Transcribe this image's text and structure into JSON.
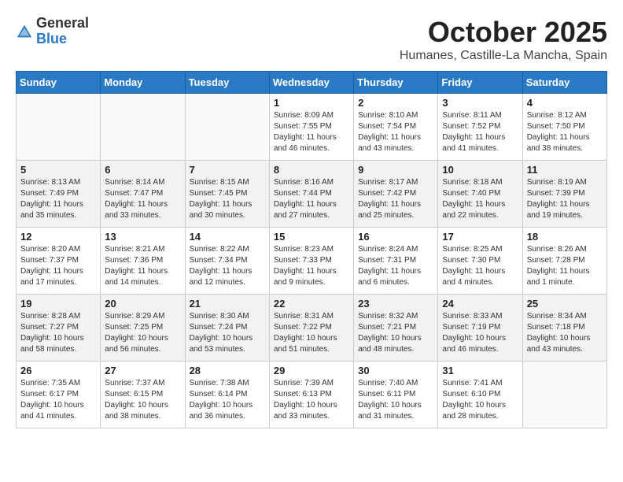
{
  "header": {
    "logo_general": "General",
    "logo_blue": "Blue",
    "month": "October 2025",
    "location": "Humanes, Castille-La Mancha, Spain"
  },
  "weekdays": [
    "Sunday",
    "Monday",
    "Tuesday",
    "Wednesday",
    "Thursday",
    "Friday",
    "Saturday"
  ],
  "weeks": [
    [
      {
        "day": "",
        "info": ""
      },
      {
        "day": "",
        "info": ""
      },
      {
        "day": "",
        "info": ""
      },
      {
        "day": "1",
        "info": "Sunrise: 8:09 AM\nSunset: 7:55 PM\nDaylight: 11 hours\nand 46 minutes."
      },
      {
        "day": "2",
        "info": "Sunrise: 8:10 AM\nSunset: 7:54 PM\nDaylight: 11 hours\nand 43 minutes."
      },
      {
        "day": "3",
        "info": "Sunrise: 8:11 AM\nSunset: 7:52 PM\nDaylight: 11 hours\nand 41 minutes."
      },
      {
        "day": "4",
        "info": "Sunrise: 8:12 AM\nSunset: 7:50 PM\nDaylight: 11 hours\nand 38 minutes."
      }
    ],
    [
      {
        "day": "5",
        "info": "Sunrise: 8:13 AM\nSunset: 7:49 PM\nDaylight: 11 hours\nand 35 minutes."
      },
      {
        "day": "6",
        "info": "Sunrise: 8:14 AM\nSunset: 7:47 PM\nDaylight: 11 hours\nand 33 minutes."
      },
      {
        "day": "7",
        "info": "Sunrise: 8:15 AM\nSunset: 7:45 PM\nDaylight: 11 hours\nand 30 minutes."
      },
      {
        "day": "8",
        "info": "Sunrise: 8:16 AM\nSunset: 7:44 PM\nDaylight: 11 hours\nand 27 minutes."
      },
      {
        "day": "9",
        "info": "Sunrise: 8:17 AM\nSunset: 7:42 PM\nDaylight: 11 hours\nand 25 minutes."
      },
      {
        "day": "10",
        "info": "Sunrise: 8:18 AM\nSunset: 7:40 PM\nDaylight: 11 hours\nand 22 minutes."
      },
      {
        "day": "11",
        "info": "Sunrise: 8:19 AM\nSunset: 7:39 PM\nDaylight: 11 hours\nand 19 minutes."
      }
    ],
    [
      {
        "day": "12",
        "info": "Sunrise: 8:20 AM\nSunset: 7:37 PM\nDaylight: 11 hours\nand 17 minutes."
      },
      {
        "day": "13",
        "info": "Sunrise: 8:21 AM\nSunset: 7:36 PM\nDaylight: 11 hours\nand 14 minutes."
      },
      {
        "day": "14",
        "info": "Sunrise: 8:22 AM\nSunset: 7:34 PM\nDaylight: 11 hours\nand 12 minutes."
      },
      {
        "day": "15",
        "info": "Sunrise: 8:23 AM\nSunset: 7:33 PM\nDaylight: 11 hours\nand 9 minutes."
      },
      {
        "day": "16",
        "info": "Sunrise: 8:24 AM\nSunset: 7:31 PM\nDaylight: 11 hours\nand 6 minutes."
      },
      {
        "day": "17",
        "info": "Sunrise: 8:25 AM\nSunset: 7:30 PM\nDaylight: 11 hours\nand 4 minutes."
      },
      {
        "day": "18",
        "info": "Sunrise: 8:26 AM\nSunset: 7:28 PM\nDaylight: 11 hours\nand 1 minute."
      }
    ],
    [
      {
        "day": "19",
        "info": "Sunrise: 8:28 AM\nSunset: 7:27 PM\nDaylight: 10 hours\nand 58 minutes."
      },
      {
        "day": "20",
        "info": "Sunrise: 8:29 AM\nSunset: 7:25 PM\nDaylight: 10 hours\nand 56 minutes."
      },
      {
        "day": "21",
        "info": "Sunrise: 8:30 AM\nSunset: 7:24 PM\nDaylight: 10 hours\nand 53 minutes."
      },
      {
        "day": "22",
        "info": "Sunrise: 8:31 AM\nSunset: 7:22 PM\nDaylight: 10 hours\nand 51 minutes."
      },
      {
        "day": "23",
        "info": "Sunrise: 8:32 AM\nSunset: 7:21 PM\nDaylight: 10 hours\nand 48 minutes."
      },
      {
        "day": "24",
        "info": "Sunrise: 8:33 AM\nSunset: 7:19 PM\nDaylight: 10 hours\nand 46 minutes."
      },
      {
        "day": "25",
        "info": "Sunrise: 8:34 AM\nSunset: 7:18 PM\nDaylight: 10 hours\nand 43 minutes."
      }
    ],
    [
      {
        "day": "26",
        "info": "Sunrise: 7:35 AM\nSunset: 6:17 PM\nDaylight: 10 hours\nand 41 minutes."
      },
      {
        "day": "27",
        "info": "Sunrise: 7:37 AM\nSunset: 6:15 PM\nDaylight: 10 hours\nand 38 minutes."
      },
      {
        "day": "28",
        "info": "Sunrise: 7:38 AM\nSunset: 6:14 PM\nDaylight: 10 hours\nand 36 minutes."
      },
      {
        "day": "29",
        "info": "Sunrise: 7:39 AM\nSunset: 6:13 PM\nDaylight: 10 hours\nand 33 minutes."
      },
      {
        "day": "30",
        "info": "Sunrise: 7:40 AM\nSunset: 6:11 PM\nDaylight: 10 hours\nand 31 minutes."
      },
      {
        "day": "31",
        "info": "Sunrise: 7:41 AM\nSunset: 6:10 PM\nDaylight: 10 hours\nand 28 minutes."
      },
      {
        "day": "",
        "info": ""
      }
    ]
  ]
}
